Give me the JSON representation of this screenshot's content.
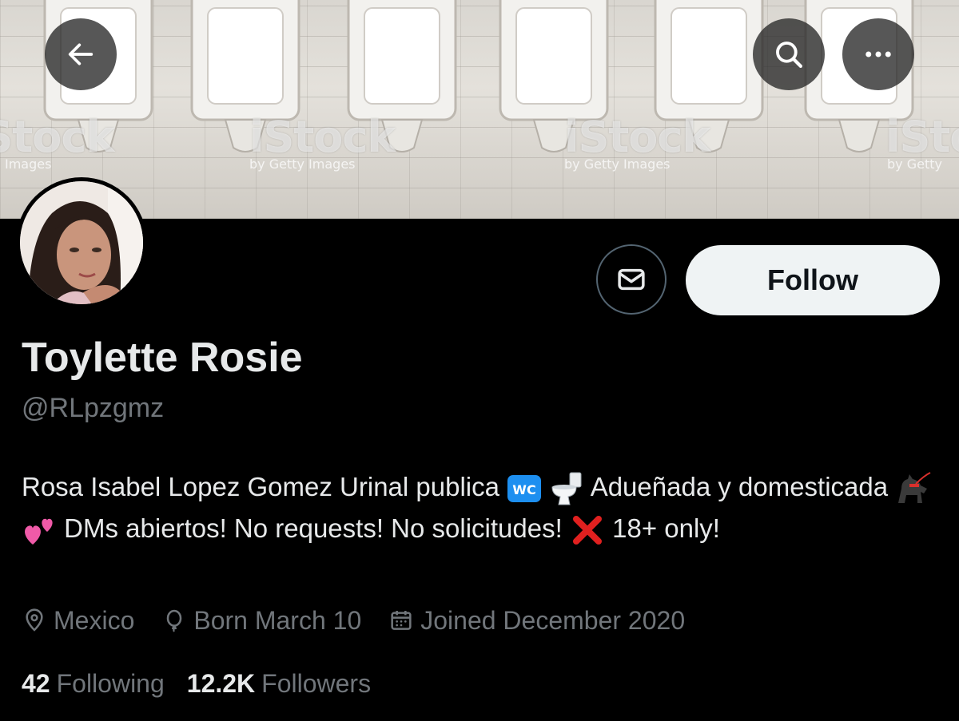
{
  "banner": {
    "watermarks": [
      "iStock",
      "iStock",
      "iStock",
      "iStock",
      "iStock"
    ],
    "watermark_sub": [
      "Images",
      "by Getty Images",
      "by Getty Images",
      "by Getty"
    ]
  },
  "topbar": {
    "back_icon": "arrow-left-icon",
    "search_icon": "search-icon",
    "more_icon": "more-horizontal-icon"
  },
  "profile": {
    "display_name": "Toylette Rosie",
    "handle": "@RLpzgmz",
    "follow_label": "Follow",
    "message_icon": "envelope-icon",
    "bio": {
      "part1": "Rosa Isabel Lopez Gomez Urinal publica",
      "part2": "Adueñada y domesticada",
      "part3": "DMs abiertos! No requests! No solicitudes!",
      "part4": "18+ only!"
    },
    "location": "Mexico",
    "birthday": "Born March 10",
    "joined": "Joined December 2020",
    "following_count": "42",
    "following_label": "Following",
    "followers_count": "12.2K",
    "followers_label": "Followers"
  },
  "colors": {
    "background": "#000000",
    "primary_text": "#e7e9ea",
    "secondary_text": "#71767b",
    "follow_button_bg": "#eff3f4"
  }
}
